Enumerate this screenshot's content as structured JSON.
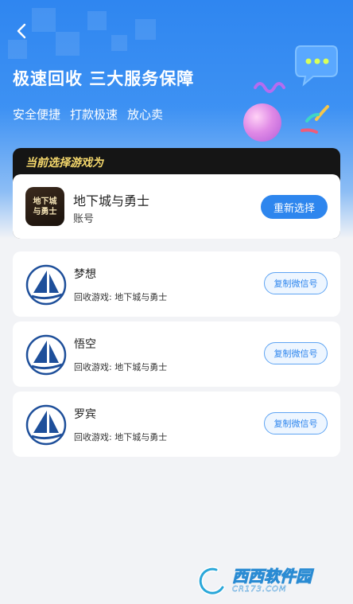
{
  "header": {
    "back_icon": "chevron-left-icon",
    "headline": "极速回收 三大服务保障",
    "features": [
      "安全便捷",
      "打款极速",
      "放心卖"
    ]
  },
  "selected_game": {
    "panel_title": "当前选择游戏为",
    "logo_text_line1": "地下城",
    "logo_text_line2": "与勇士",
    "name": "地下城与勇士",
    "type": "账号",
    "reselect_label": "重新选择"
  },
  "agents": [
    {
      "name": "梦想",
      "game_label": "回收游戏: 地下城与勇士",
      "copy_label": "复制微信号",
      "avatar_icon": "sailboat-icon"
    },
    {
      "name": "悟空",
      "game_label": "回收游戏: 地下城与勇士",
      "copy_label": "复制微信号",
      "avatar_icon": "sailboat-icon"
    },
    {
      "name": "罗宾",
      "game_label": "回收游戏: 地下城与勇士",
      "copy_label": "复制微信号",
      "avatar_icon": "sailboat-icon"
    }
  ],
  "watermark": {
    "brand": "西西软件园",
    "domain": "CR173.COM"
  },
  "colors": {
    "accent": "#2e86ee",
    "hero_top": "#2f86f0",
    "panel_dark": "#151515",
    "panel_title": "#f5d86c",
    "page_bg": "#f2f3f6"
  }
}
